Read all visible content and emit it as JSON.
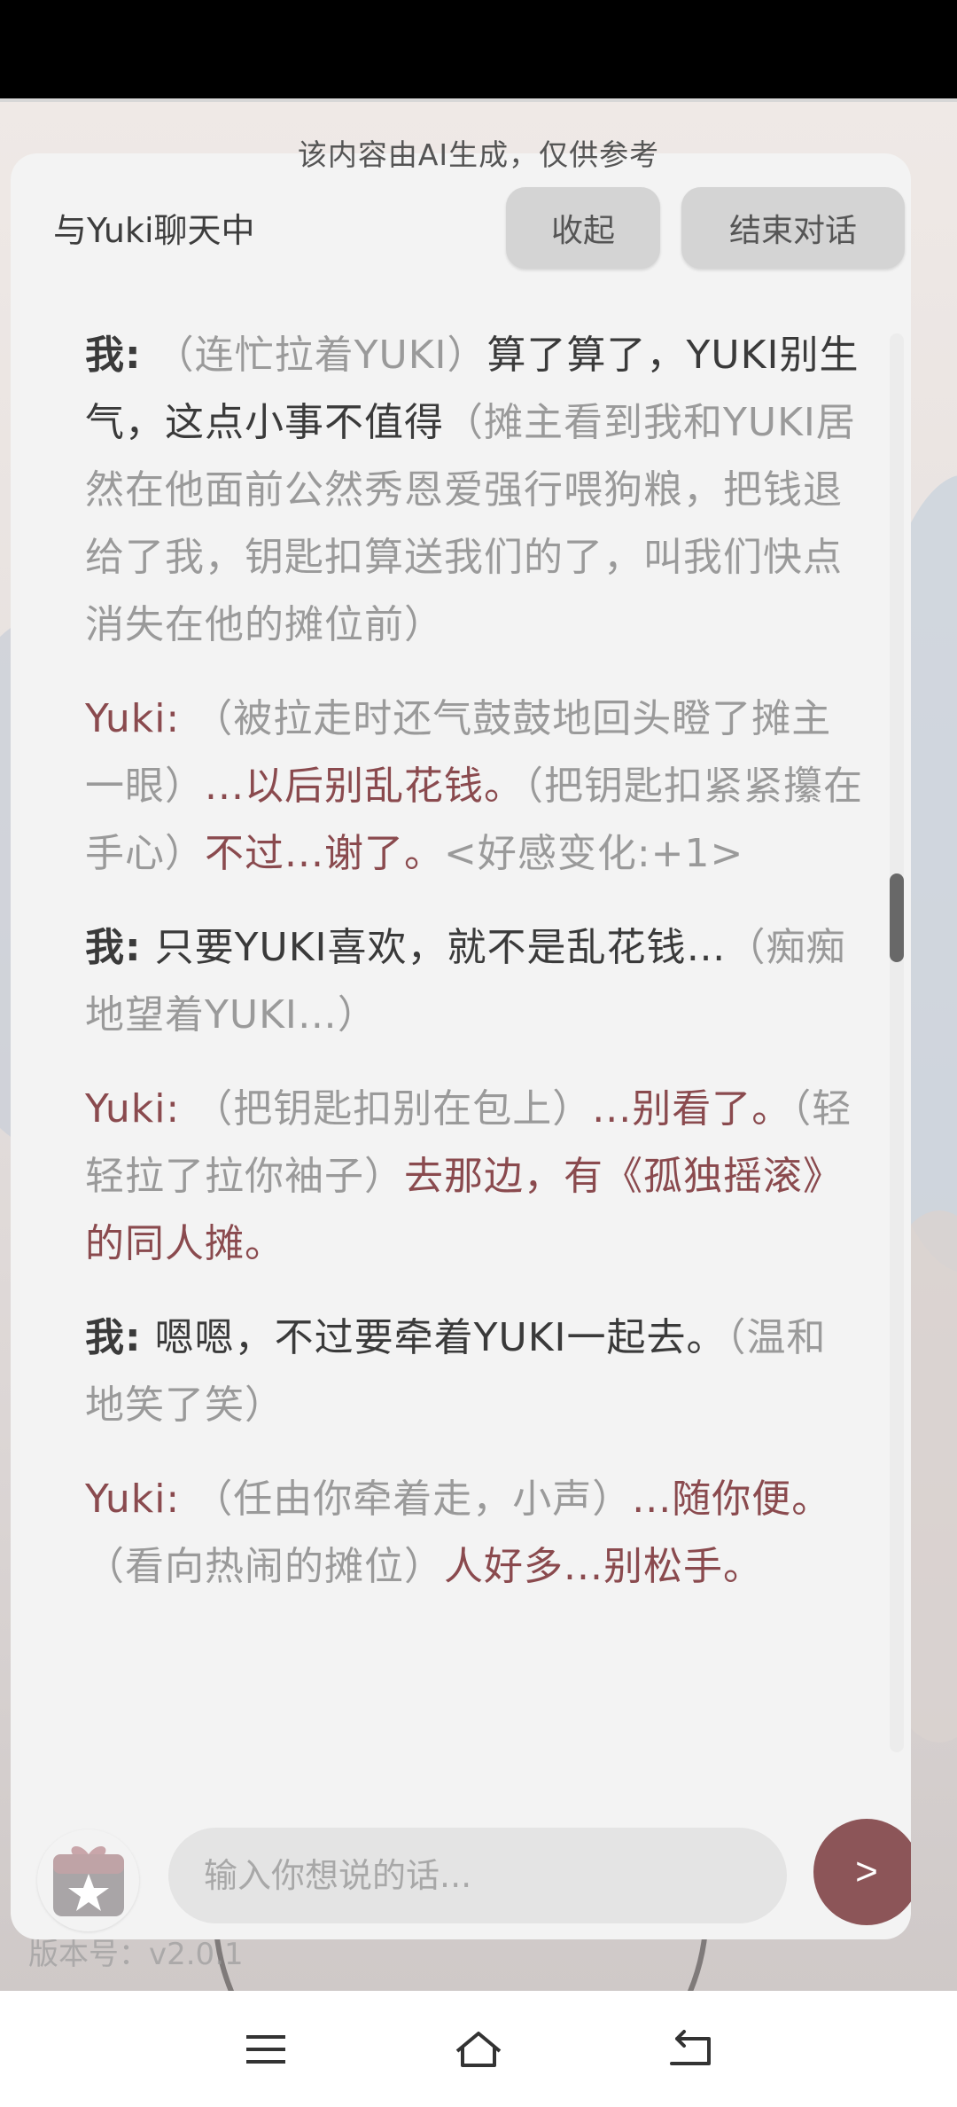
{
  "ai_notice": "该内容由AI生成，仅供参考",
  "header": {
    "title": "与Yuki聊天中",
    "collapse_label": "收起",
    "end_label": "结束对话"
  },
  "messages": [
    {
      "speaker": "我:",
      "segments": [
        {
          "type": "action",
          "text": "（连忙拉着YUKI）"
        },
        {
          "type": "speech",
          "text": "算了算了，YUKI别生气，这点小事不值得"
        },
        {
          "type": "action",
          "text": "（摊主看到我和YUKI居然在他面前公然秀恩爱强行喂狗粮，把钱退给了我，钥匙扣算送我们的了，叫我们快点消失在他的摊位前）"
        }
      ]
    },
    {
      "speaker": "Yuki:",
      "segments": [
        {
          "type": "action",
          "text": "（被拉走时还气鼓鼓地回头瞪了摊主一眼）"
        },
        {
          "type": "speech",
          "text": "...以后别乱花钱。"
        },
        {
          "type": "action",
          "text": "（把钥匙扣紧紧攥在手心）"
        },
        {
          "type": "speech",
          "text": "不过...谢了。"
        },
        {
          "type": "action",
          "text": "<好感变化:+1>"
        }
      ]
    },
    {
      "speaker": "我:",
      "segments": [
        {
          "type": "speech",
          "text": "只要YUKI喜欢，就不是乱花钱…"
        },
        {
          "type": "action",
          "text": "（痴痴地望着YUKI…）"
        }
      ]
    },
    {
      "speaker": "Yuki:",
      "segments": [
        {
          "type": "action",
          "text": "（把钥匙扣别在包上）"
        },
        {
          "type": "speech",
          "text": "...别看了。"
        },
        {
          "type": "action",
          "text": "（轻轻拉了拉你袖子）"
        },
        {
          "type": "speech",
          "text": "去那边，有《孤独摇滚》的同人摊。"
        }
      ]
    },
    {
      "speaker": "我:",
      "segments": [
        {
          "type": "speech",
          "text": "嗯嗯，不过要牵着YUKI一起去。"
        },
        {
          "type": "action",
          "text": "（温和地笑了笑）"
        }
      ]
    },
    {
      "speaker": "Yuki:",
      "segments": [
        {
          "type": "action",
          "text": "（任由你牵着走，小声）"
        },
        {
          "type": "speech",
          "text": "...随你便。"
        },
        {
          "type": "action",
          "text": "（看向热闹的摊位）"
        },
        {
          "type": "speech",
          "text": "人好多...别松手。"
        }
      ]
    }
  ],
  "input": {
    "placeholder": "输入你想说的话...",
    "value": ""
  },
  "send_label": ">",
  "gift_icon": "gift-star-icon",
  "version_text": "版本号：v2.0.1",
  "colors": {
    "accent": "#8c5558",
    "yuki_text": "#8a4a4e",
    "action_text": "#9a9a9a",
    "panel_bg": "#f3f3f3"
  },
  "nav": {
    "menu_icon": "menu-icon",
    "home_icon": "home-icon",
    "back_icon": "back-icon"
  }
}
